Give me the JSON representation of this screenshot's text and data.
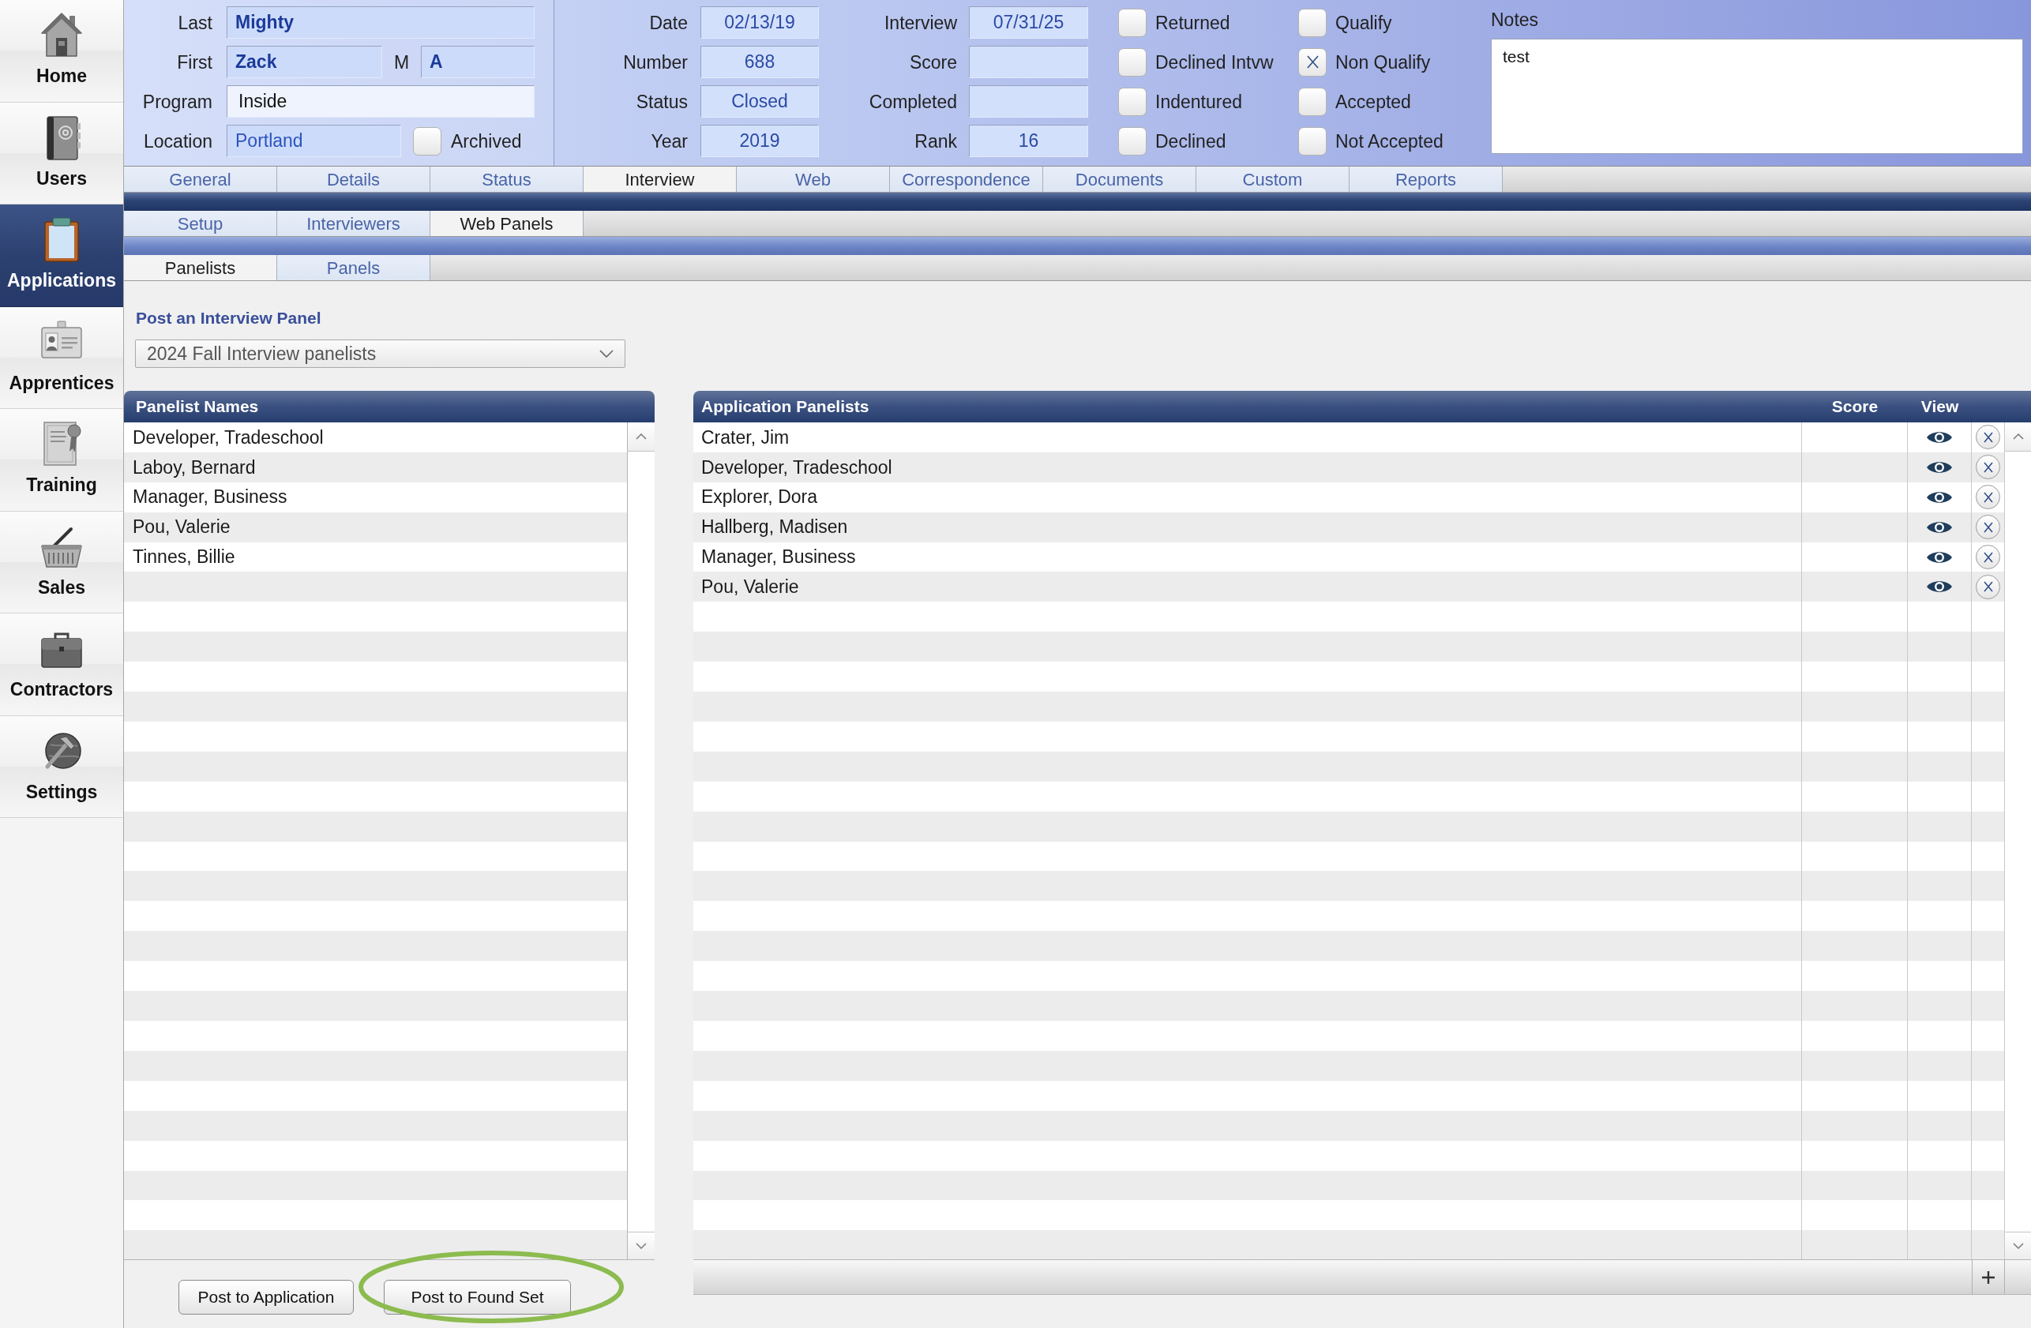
{
  "sidebar": {
    "items": [
      {
        "label": "Home",
        "selected": false
      },
      {
        "label": "Users",
        "selected": false
      },
      {
        "label": "Applications",
        "selected": true
      },
      {
        "label": "Apprentices",
        "selected": false
      },
      {
        "label": "Training",
        "selected": false
      },
      {
        "label": "Sales",
        "selected": false
      },
      {
        "label": "Contractors",
        "selected": false
      },
      {
        "label": "Settings",
        "selected": false
      }
    ]
  },
  "record": {
    "last": {
      "label": "Last",
      "value": "Mighty"
    },
    "first": {
      "label": "First",
      "value": "Zack"
    },
    "middle": {
      "label": "M",
      "value": "A"
    },
    "program": {
      "label": "Program",
      "value": "Inside"
    },
    "location": {
      "label": "Location",
      "value": "Portland"
    },
    "archived": {
      "label": "Archived",
      "checked": false
    },
    "details": [
      {
        "label": "Date",
        "value": "02/13/19"
      },
      {
        "label": "Number",
        "value": "688"
      },
      {
        "label": "Status",
        "value": "Closed"
      },
      {
        "label": "Year",
        "value": "2019"
      }
    ],
    "interview": [
      {
        "label": "Interview",
        "value": "07/31/25"
      },
      {
        "label": "Score"
      },
      {
        "label": "Completed"
      },
      {
        "label": "Rank",
        "value": "16"
      }
    ],
    "flags": [
      {
        "label": "Returned",
        "checked": false
      },
      {
        "label": "Declined Intvw",
        "checked": false
      },
      {
        "label": "Indentured",
        "checked": false
      },
      {
        "label": "Declined",
        "checked": false
      }
    ],
    "outcomes": [
      {
        "label": "Qualify",
        "checked": false
      },
      {
        "label": "Non Qualify",
        "checked": true
      },
      {
        "label": "Accepted",
        "checked": false
      },
      {
        "label": "Not Accepted",
        "checked": false
      }
    ],
    "notes": {
      "label": "Notes",
      "value": "test"
    }
  },
  "tabs": [
    {
      "label": "General",
      "selected": false
    },
    {
      "label": "Details",
      "selected": false
    },
    {
      "label": "Status",
      "selected": false
    },
    {
      "label": "Interview",
      "selected": true
    },
    {
      "label": "Web",
      "selected": false
    },
    {
      "label": "Correspondence",
      "selected": false
    },
    {
      "label": "Documents",
      "selected": false
    },
    {
      "label": "Custom",
      "selected": false
    },
    {
      "label": "Reports",
      "selected": false
    }
  ],
  "subtabs": [
    {
      "label": "Setup",
      "selected": false
    },
    {
      "label": "Interviewers",
      "selected": false
    },
    {
      "label": "Web Panels",
      "selected": true
    }
  ],
  "panel_tabs": [
    {
      "label": "Panelists",
      "selected": true
    },
    {
      "label": "Panels",
      "selected": false
    }
  ],
  "panel_picker": {
    "title": "Post an Interview Panel",
    "value": "2024 Fall Interview panelists"
  },
  "panelist_list": {
    "title": "Panelist Names",
    "rows": [
      "Developer, Tradeschool",
      "Laboy, Bernard",
      "Manager, Business",
      "Pou, Valerie",
      "Tinnes, Billie"
    ]
  },
  "application_panelists": {
    "columns": [
      "Application Panelists",
      "Score",
      "View"
    ],
    "rows": [
      {
        "name": "Crater, Jim"
      },
      {
        "name": "Developer, Tradeschool"
      },
      {
        "name": "Explorer, Dora"
      },
      {
        "name": "Hallberg, Madisen"
      },
      {
        "name": "Manager, Business"
      },
      {
        "name": "Pou, Valerie"
      }
    ]
  },
  "buttons": [
    {
      "label": "Post to Application",
      "highlighted": false
    },
    {
      "label": "Post to Found Set",
      "highlighted": true
    }
  ]
}
